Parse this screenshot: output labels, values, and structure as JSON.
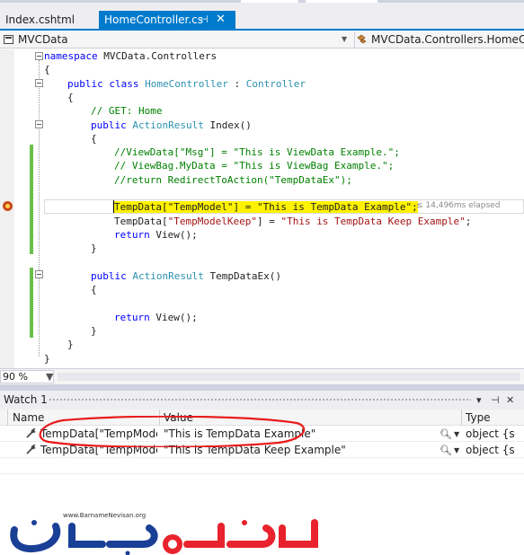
{
  "tabs": [
    {
      "label": "Index.cshtml",
      "active": false
    },
    {
      "label": "HomeController.cs",
      "active": true,
      "pin_glyph": "⊣",
      "close_glyph": "✕"
    }
  ],
  "navbar": {
    "project": "MVCData",
    "class_path": "MVCData.Controllers.HomeCont"
  },
  "code": [
    {
      "indent": 0,
      "parts": [
        {
          "t": "kw",
          "v": "namespace"
        },
        {
          "t": "",
          "v": " MVCData.Controllers"
        }
      ]
    },
    {
      "indent": 0,
      "parts": [
        {
          "t": "",
          "v": "{"
        }
      ]
    },
    {
      "indent": 1,
      "parts": [
        {
          "t": "kw",
          "v": "public"
        },
        {
          "t": "",
          "v": " "
        },
        {
          "t": "kw",
          "v": "class"
        },
        {
          "t": "",
          "v": " "
        },
        {
          "t": "type",
          "v": "HomeController"
        },
        {
          "t": "",
          "v": " : "
        },
        {
          "t": "type",
          "v": "Controller"
        }
      ]
    },
    {
      "indent": 1,
      "parts": [
        {
          "t": "",
          "v": "{"
        }
      ]
    },
    {
      "indent": 2,
      "parts": [
        {
          "t": "cmt",
          "v": "// GET: Home"
        }
      ]
    },
    {
      "indent": 2,
      "parts": [
        {
          "t": "kw",
          "v": "public"
        },
        {
          "t": "",
          "v": " "
        },
        {
          "t": "type",
          "v": "ActionResult"
        },
        {
          "t": "",
          "v": " Index()"
        }
      ]
    },
    {
      "indent": 2,
      "parts": [
        {
          "t": "",
          "v": "{"
        }
      ]
    },
    {
      "indent": 3,
      "parts": [
        {
          "t": "cmt",
          "v": "//ViewData[\"Msg\"] = \"This is ViewData Example.\";"
        }
      ]
    },
    {
      "indent": 3,
      "parts": [
        {
          "t": "cmt",
          "v": "// ViewBag.MyData = \"This is ViewBag Example.\";"
        }
      ]
    },
    {
      "indent": 3,
      "parts": [
        {
          "t": "cmt",
          "v": "//return RedirectToAction(\"TempDataEx\");"
        }
      ]
    },
    {
      "indent": 3,
      "parts": []
    },
    {
      "indent": 3,
      "parts": [
        {
          "t": "hl",
          "v": "TempData[\"TempModel\"] = \"This is TempData Example\";"
        }
      ]
    },
    {
      "indent": 3,
      "parts": [
        {
          "t": "",
          "v": "TempData["
        },
        {
          "t": "str",
          "v": "\"TempModelKeep\""
        },
        {
          "t": "",
          "v": "] = "
        },
        {
          "t": "str",
          "v": "\"This is TempData Keep Example\""
        },
        {
          "t": "",
          "v": ";"
        }
      ]
    },
    {
      "indent": 3,
      "parts": [
        {
          "t": "kw",
          "v": "return"
        },
        {
          "t": "",
          "v": " View();"
        }
      ]
    },
    {
      "indent": 2,
      "parts": [
        {
          "t": "",
          "v": "}"
        }
      ]
    },
    {
      "indent": 2,
      "parts": []
    },
    {
      "indent": 2,
      "parts": [
        {
          "t": "kw",
          "v": "public"
        },
        {
          "t": "",
          "v": " "
        },
        {
          "t": "type",
          "v": "ActionResult"
        },
        {
          "t": "",
          "v": " TempDataEx()"
        }
      ]
    },
    {
      "indent": 2,
      "parts": [
        {
          "t": "",
          "v": "{"
        }
      ]
    },
    {
      "indent": 2,
      "parts": []
    },
    {
      "indent": 3,
      "parts": [
        {
          "t": "kw",
          "v": "return"
        },
        {
          "t": "",
          "v": " View();"
        }
      ]
    },
    {
      "indent": 2,
      "parts": [
        {
          "t": "",
          "v": "}"
        }
      ]
    },
    {
      "indent": 1,
      "parts": [
        {
          "t": "",
          "v": "}"
        }
      ]
    },
    {
      "indent": 0,
      "parts": [
        {
          "t": "",
          "v": "}"
        }
      ]
    }
  ],
  "elapsed_tip": "≤ 14,496ms elapsed",
  "zoom": "90 %",
  "watch": {
    "title": "Watch 1",
    "buttons": [
      "▾",
      "⊣",
      "✕"
    ],
    "columns": {
      "name": "Name",
      "value": "Value",
      "type": "Type"
    },
    "rows": [
      {
        "name": "TempData[\"TempModel\"",
        "value": "\"This is TempData Example\"",
        "type": "object {s"
      },
      {
        "name": "TempData[\"TempModelKe",
        "value": "\"This is TempData Keep Example\"",
        "type": "object {s"
      }
    ]
  },
  "logo": {
    "url": "www.BarnameNevisan.org",
    "wordmark": "برنامه نویسان",
    "colors": {
      "primary": "#1a3f96",
      "accent": "#e8232d"
    }
  },
  "colors": {
    "accent": "#007acc",
    "highlight": "#fff200",
    "annotation": "#e81b1b"
  }
}
